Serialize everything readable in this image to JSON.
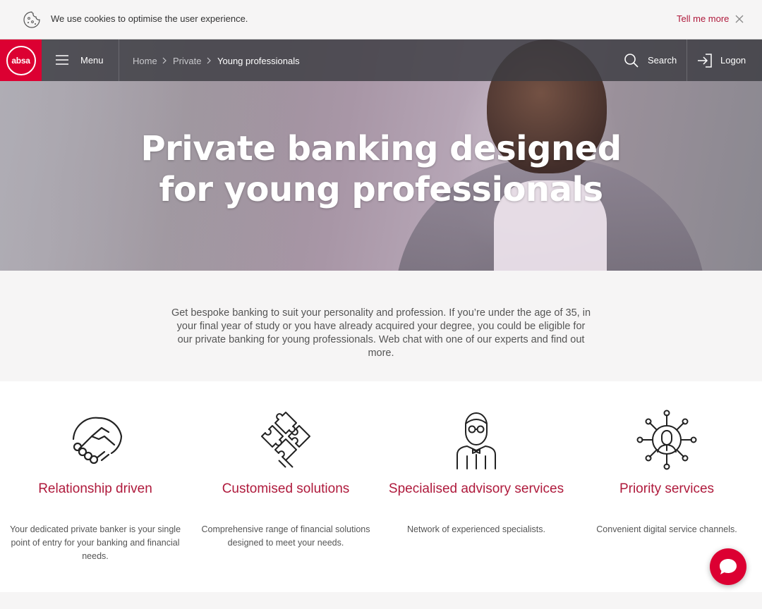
{
  "cookie_bar": {
    "message": "We use cookies to optimise the user experience.",
    "link_label": "Tell me more",
    "icons": [
      "cookie-icon",
      "close-icon"
    ]
  },
  "nav": {
    "logo_text": "absa",
    "menu_label": "Menu",
    "breadcrumb": [
      "Home",
      "Private",
      "Young professionals"
    ],
    "search_label": "Search",
    "logon_label": "Logon",
    "icons": [
      "hamburger-icon",
      "chevron-right-icon",
      "search-icon",
      "login-icon"
    ]
  },
  "hero": {
    "title_line1": "Private banking designed",
    "title_line2": "for young professionals"
  },
  "intro": {
    "text": "Get bespoke banking to suit your personality and profession. If you’re under the age of 35, in your final year of study or you have already acquired your degree, you could be eligible for our private banking for young professionals. Web chat with one of our experts and find out more."
  },
  "features": [
    {
      "title": "Relationship driven",
      "description": "Your dedicated private banker is your single point of entry for your banking and financial needs.",
      "icon": "handshake-icon"
    },
    {
      "title": "Customised solutions",
      "description": "Comprehensive range of financial solutions designed to meet your needs.",
      "icon": "puzzle-icon"
    },
    {
      "title": "Specialised advisory services",
      "description": "Network of experienced specialists.",
      "icon": "advisor-icon"
    },
    {
      "title": "Priority services",
      "description": "Convenient digital service channels.",
      "icon": "network-person-icon"
    }
  ],
  "chat": {
    "icon": "chat-bubble-icon"
  },
  "colors": {
    "brand_red": "#dc0032",
    "accent_text": "#af1a3c",
    "nav_bg": "#3c3c42"
  }
}
